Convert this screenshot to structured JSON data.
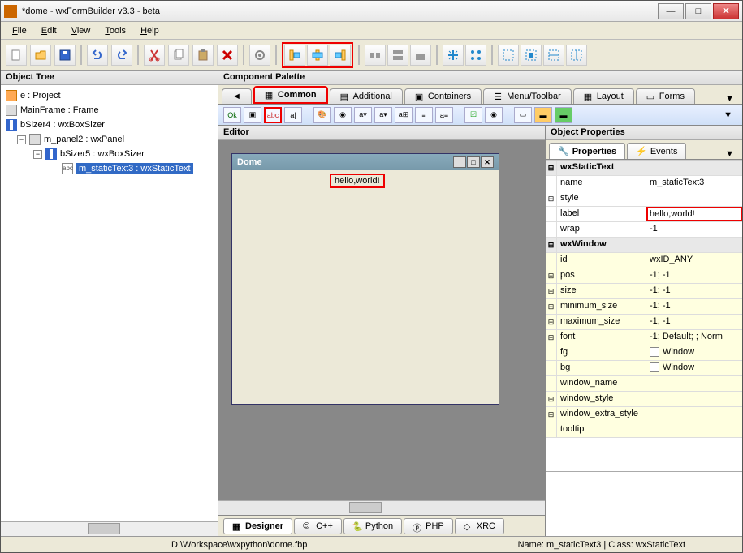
{
  "window": {
    "title": "*dome - wxFormBuilder v3.3 - beta"
  },
  "menu": {
    "file": "File",
    "edit": "Edit",
    "view": "View",
    "tools": "Tools",
    "help": "Help"
  },
  "panels": {
    "objectTree": "Object Tree",
    "palette": "Component Palette",
    "editor": "Editor",
    "properties": "Object Properties"
  },
  "tree": {
    "n0": "e : Project",
    "n1": "MainFrame : Frame",
    "n2": "bSizer4 : wxBoxSizer",
    "n3": "m_panel2 : wxPanel",
    "n4": "bSizer5 : wxBoxSizer",
    "n5": "m_staticText3 : wxStaticText"
  },
  "paletteTabs": {
    "common": "Common",
    "additional": "Additional",
    "containers": "Containers",
    "menu": "Menu/Toolbar",
    "layout": "Layout",
    "forms": "Forms"
  },
  "form": {
    "title": "Dome",
    "staticText": "hello,world!"
  },
  "propTabs": {
    "properties": "Properties",
    "events": "Events"
  },
  "props": {
    "grp1": "wxStaticText",
    "name_l": "name",
    "name_v": "m_staticText3",
    "style_l": "style",
    "style_v": "",
    "label_l": "label",
    "label_v": "hello,world!",
    "wrap_l": "wrap",
    "wrap_v": "-1",
    "grp2": "wxWindow",
    "id_l": "id",
    "id_v": "wxID_ANY",
    "pos_l": "pos",
    "pos_v": "-1; -1",
    "size_l": "size",
    "size_v": "-1; -1",
    "min_l": "minimum_size",
    "min_v": "-1; -1",
    "max_l": "maximum_size",
    "max_v": "-1; -1",
    "font_l": "font",
    "font_v": "-1; Default; ; Norm",
    "fg_l": "fg",
    "fg_v": "Window",
    "bg_l": "bg",
    "bg_v": "Window",
    "wname_l": "window_name",
    "wname_v": "",
    "wstyle_l": "window_style",
    "wstyle_v": "",
    "wextra_l": "window_extra_style",
    "wextra_v": "",
    "tooltip_l": "tooltip",
    "tooltip_v": ""
  },
  "bottomTabs": {
    "designer": "Designer",
    "cpp": "C++",
    "python": "Python",
    "php": "PHP",
    "xrc": "XRC"
  },
  "status": {
    "path": "D:\\Workspace\\wxpython\\dome.fbp",
    "info": "Name: m_staticText3 | Class: wxStaticText"
  }
}
